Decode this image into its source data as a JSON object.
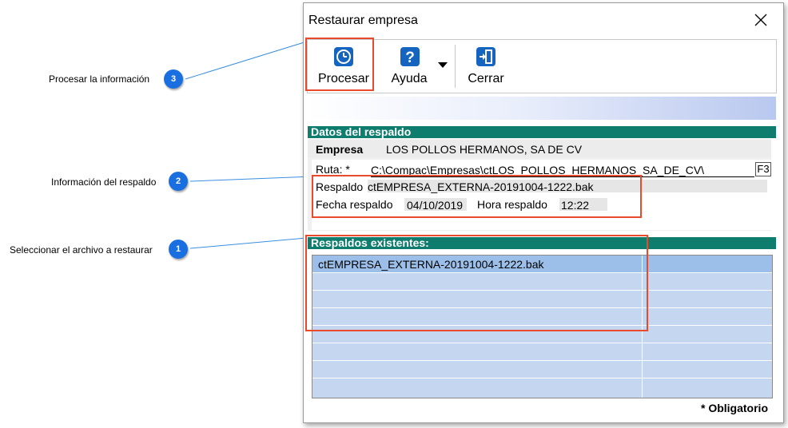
{
  "window": {
    "title": "Restaurar empresa",
    "close_symbol": "✕"
  },
  "toolbar": {
    "procesar_label": "Procesar",
    "ayuda_label": "Ayuda",
    "cerrar_label": "Cerrar"
  },
  "datos": {
    "header": "Datos del respaldo",
    "empresa_label": "Empresa",
    "empresa_value": "LOS POLLOS HERMANOS, SA DE CV",
    "ruta_label": "Ruta: *",
    "ruta_value": "C:\\Compac\\Empresas\\ctLOS_POLLOS_HERMANOS_SA_DE_CV\\",
    "ruta_button": "F3",
    "respaldo_label": "Respaldo",
    "respaldo_value": "ctEMPRESA_EXTERNA-20191004-1222.bak",
    "fecha_label": "Fecha respaldo",
    "fecha_value": "04/10/2019",
    "hora_label": "Hora respaldo",
    "hora_value": "12:22"
  },
  "existentes": {
    "header": "Respaldos existentes:",
    "rows": [
      "ctEMPRESA_EXTERNA-20191004-1222.bak",
      "",
      "",
      "",
      "",
      "",
      "",
      ""
    ]
  },
  "footer": {
    "obligatorio": "* Obligatorio"
  },
  "annotations": [
    {
      "number": "3",
      "label": "Procesar la información"
    },
    {
      "number": "2",
      "label": "Información del respaldo"
    },
    {
      "number": "1",
      "label": "Seleccionar el archivo a restaurar"
    }
  ],
  "colors": {
    "section_header": "#0f7d6e",
    "badge": "#1a6fe0",
    "highlight": "#e84a2b",
    "grid_bg": "#c5d6f0",
    "grid_selected": "#9cbfea",
    "icon_blue": "#1565c0"
  }
}
